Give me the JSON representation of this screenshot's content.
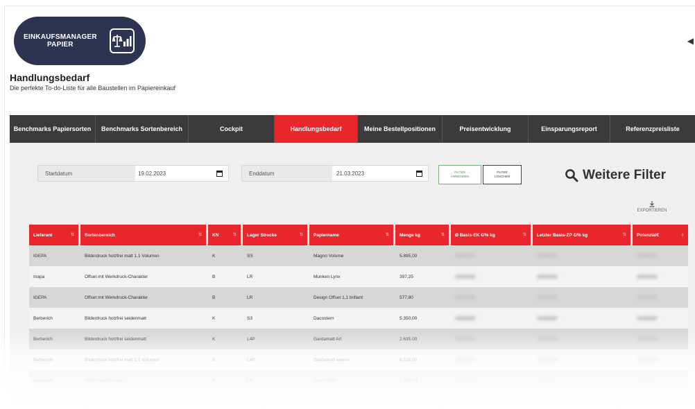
{
  "logo": {
    "line1": "EINKAUFSMANAGER",
    "line2": "PAPIER",
    "icon": "scale-chart-icon"
  },
  "header": {
    "title": "Handlungsbedarf",
    "subtitle": "Die perfekte To-do-Liste für alle Baustellen im Papiereinkauf"
  },
  "nav": {
    "items": [
      {
        "label": "Benchmarks Papiersorten"
      },
      {
        "label": "Benchmarks Sortenbereich"
      },
      {
        "label": "Cockpit"
      },
      {
        "label": "Handlungsbedarf"
      },
      {
        "label": "Meine Bestellpositionen"
      },
      {
        "label": "Preisentwicklung"
      },
      {
        "label": "Einsparungsreport"
      },
      {
        "label": "Referenzpreisliste"
      }
    ],
    "active": "Handlungsbedarf"
  },
  "filters": {
    "start_label": "Startdatum",
    "start_value": "19.02.2023",
    "end_label": "Enddatum",
    "end_value": "21.03.2023",
    "apply_line1": "FILTER",
    "apply_line2": "ANWENDEN",
    "clear_line1": "FILTER",
    "clear_line2": "LÖSCHEN",
    "more_filters": "Weitere Filter",
    "export_label": "EXPORTIEREN"
  },
  "table": {
    "columns": [
      "Lieferant",
      "Sortenbereich",
      "KN",
      "Lager Strecke",
      "Papiername",
      "Menge kg",
      "Ø Basis-EK €/% kg",
      "Letzter Basis-ZP €/% kg",
      "Potenzial€"
    ],
    "rows": [
      [
        "IGEPA",
        "Bilderdruck holzfrei matt 1,1 Volumen",
        "K",
        "SS",
        "Magno Volume",
        "5.895,00"
      ],
      [
        "Inapa",
        "Offset mit Werkdruck-Charakter",
        "B",
        "LR",
        "Munken Lynx",
        "397,25"
      ],
      [
        "IGEPA",
        "Offset mit Werkdruck-Charakter",
        "B",
        "LR",
        "Design Offset 1,1 brillant",
        "577,80"
      ],
      [
        "Berberich",
        "Bilderdruck holzfrei seidenmatt",
        "K",
        "S3",
        "Dacostern",
        "5.350,00"
      ],
      [
        "Berberich",
        "Bilderdruck holzfrei seidenmatt",
        "K",
        "L4P",
        "Gardamatt Art",
        "2.635,00"
      ],
      [
        "Berberich",
        "Bilderdruck holzfrei matt 1,1 Volumen",
        "K",
        "L4P",
        "Gardamatt eleven",
        "6.225,00"
      ],
      [
        "Berberich",
        "Offset holzfrei weiß",
        "K",
        "LP",
        "Juno Offset",
        "1.245,00"
      ]
    ]
  },
  "colors": {
    "accent": "#e8262b",
    "nav_bg": "#3b3b3b",
    "logo_bg": "#2d3350",
    "panel_bg": "#efefef"
  }
}
